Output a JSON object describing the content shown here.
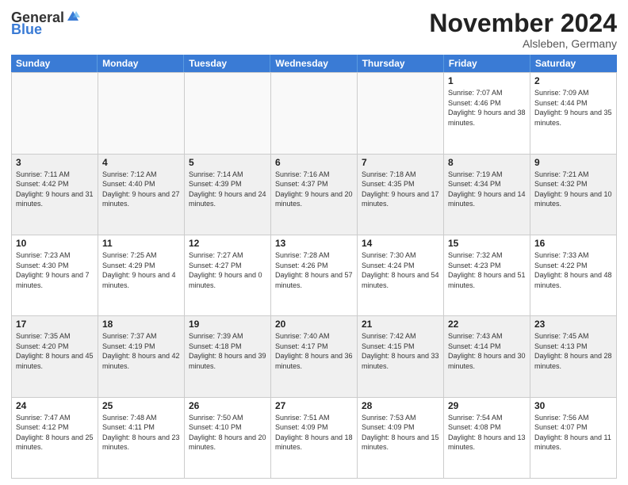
{
  "logo": {
    "general": "General",
    "blue": "Blue"
  },
  "title": "November 2024",
  "location": "Alsleben, Germany",
  "days_of_week": [
    "Sunday",
    "Monday",
    "Tuesday",
    "Wednesday",
    "Thursday",
    "Friday",
    "Saturday"
  ],
  "weeks": [
    [
      {
        "day": "",
        "empty": true
      },
      {
        "day": "",
        "empty": true
      },
      {
        "day": "",
        "empty": true
      },
      {
        "day": "",
        "empty": true
      },
      {
        "day": "",
        "empty": true
      },
      {
        "day": "1",
        "sunrise": "7:07 AM",
        "sunset": "4:46 PM",
        "daylight": "9 hours and 38 minutes."
      },
      {
        "day": "2",
        "sunrise": "7:09 AM",
        "sunset": "4:44 PM",
        "daylight": "9 hours and 35 minutes."
      }
    ],
    [
      {
        "day": "3",
        "sunrise": "7:11 AM",
        "sunset": "4:42 PM",
        "daylight": "9 hours and 31 minutes."
      },
      {
        "day": "4",
        "sunrise": "7:12 AM",
        "sunset": "4:40 PM",
        "daylight": "9 hours and 27 minutes."
      },
      {
        "day": "5",
        "sunrise": "7:14 AM",
        "sunset": "4:39 PM",
        "daylight": "9 hours and 24 minutes."
      },
      {
        "day": "6",
        "sunrise": "7:16 AM",
        "sunset": "4:37 PM",
        "daylight": "9 hours and 20 minutes."
      },
      {
        "day": "7",
        "sunrise": "7:18 AM",
        "sunset": "4:35 PM",
        "daylight": "9 hours and 17 minutes."
      },
      {
        "day": "8",
        "sunrise": "7:19 AM",
        "sunset": "4:34 PM",
        "daylight": "9 hours and 14 minutes."
      },
      {
        "day": "9",
        "sunrise": "7:21 AM",
        "sunset": "4:32 PM",
        "daylight": "9 hours and 10 minutes."
      }
    ],
    [
      {
        "day": "10",
        "sunrise": "7:23 AM",
        "sunset": "4:30 PM",
        "daylight": "9 hours and 7 minutes."
      },
      {
        "day": "11",
        "sunrise": "7:25 AM",
        "sunset": "4:29 PM",
        "daylight": "9 hours and 4 minutes."
      },
      {
        "day": "12",
        "sunrise": "7:27 AM",
        "sunset": "4:27 PM",
        "daylight": "9 hours and 0 minutes."
      },
      {
        "day": "13",
        "sunrise": "7:28 AM",
        "sunset": "4:26 PM",
        "daylight": "8 hours and 57 minutes."
      },
      {
        "day": "14",
        "sunrise": "7:30 AM",
        "sunset": "4:24 PM",
        "daylight": "8 hours and 54 minutes."
      },
      {
        "day": "15",
        "sunrise": "7:32 AM",
        "sunset": "4:23 PM",
        "daylight": "8 hours and 51 minutes."
      },
      {
        "day": "16",
        "sunrise": "7:33 AM",
        "sunset": "4:22 PM",
        "daylight": "8 hours and 48 minutes."
      }
    ],
    [
      {
        "day": "17",
        "sunrise": "7:35 AM",
        "sunset": "4:20 PM",
        "daylight": "8 hours and 45 minutes."
      },
      {
        "day": "18",
        "sunrise": "7:37 AM",
        "sunset": "4:19 PM",
        "daylight": "8 hours and 42 minutes."
      },
      {
        "day": "19",
        "sunrise": "7:39 AM",
        "sunset": "4:18 PM",
        "daylight": "8 hours and 39 minutes."
      },
      {
        "day": "20",
        "sunrise": "7:40 AM",
        "sunset": "4:17 PM",
        "daylight": "8 hours and 36 minutes."
      },
      {
        "day": "21",
        "sunrise": "7:42 AM",
        "sunset": "4:15 PM",
        "daylight": "8 hours and 33 minutes."
      },
      {
        "day": "22",
        "sunrise": "7:43 AM",
        "sunset": "4:14 PM",
        "daylight": "8 hours and 30 minutes."
      },
      {
        "day": "23",
        "sunrise": "7:45 AM",
        "sunset": "4:13 PM",
        "daylight": "8 hours and 28 minutes."
      }
    ],
    [
      {
        "day": "24",
        "sunrise": "7:47 AM",
        "sunset": "4:12 PM",
        "daylight": "8 hours and 25 minutes."
      },
      {
        "day": "25",
        "sunrise": "7:48 AM",
        "sunset": "4:11 PM",
        "daylight": "8 hours and 23 minutes."
      },
      {
        "day": "26",
        "sunrise": "7:50 AM",
        "sunset": "4:10 PM",
        "daylight": "8 hours and 20 minutes."
      },
      {
        "day": "27",
        "sunrise": "7:51 AM",
        "sunset": "4:09 PM",
        "daylight": "8 hours and 18 minutes."
      },
      {
        "day": "28",
        "sunrise": "7:53 AM",
        "sunset": "4:09 PM",
        "daylight": "8 hours and 15 minutes."
      },
      {
        "day": "29",
        "sunrise": "7:54 AM",
        "sunset": "4:08 PM",
        "daylight": "8 hours and 13 minutes."
      },
      {
        "day": "30",
        "sunrise": "7:56 AM",
        "sunset": "4:07 PM",
        "daylight": "8 hours and 11 minutes."
      }
    ]
  ]
}
